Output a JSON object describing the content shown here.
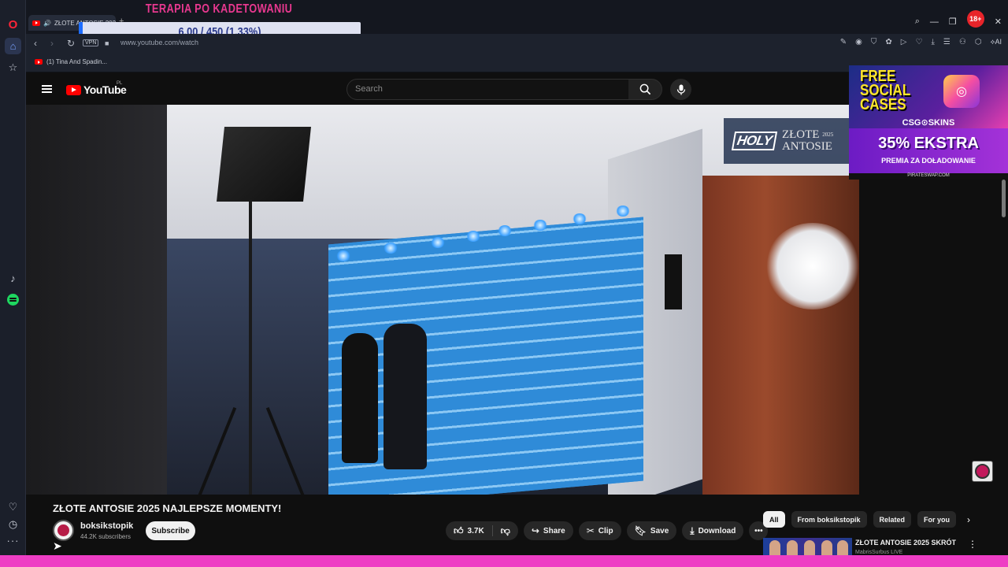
{
  "browser": {
    "tab_title": "ZŁOTE ANTOSIE 2025",
    "tab_add": "+",
    "badge": "18+",
    "url": "www.youtube.com/watch",
    "vpn_label": "VPN",
    "ai_label": "AI",
    "bookmark": "(1) Tina And Spadin..."
  },
  "overlay": {
    "title": "TERAPIA PO KADETOWANIU",
    "progress_text": "6.00 / 450 (1.33%)",
    "progress_fraction": 0.0133
  },
  "youtube": {
    "logo_text": "YouTube",
    "region": "PL",
    "search_placeholder": "Search"
  },
  "video_overlay": {
    "brand": "HOLY",
    "event": "ZŁOTE",
    "event2": "ANTOSIE",
    "year": "2025"
  },
  "ad": {
    "line1": "FREE",
    "line2": "SOCIAL",
    "line3": "CASES",
    "brand": "CSG⊙SKINS",
    "promo": "35% EKSTRA",
    "promo_sub": "PREMIA ZA DOŁADOWANIE",
    "site": "PIRATESWAP.COM"
  },
  "video": {
    "title": "ZŁOTE ANTOSIE 2025 NAJLEPSZE MOMENTY!",
    "channel": "boksikstopik",
    "subscribers": "44.2K subscribers",
    "subscribe_label": "Subscribe",
    "likes": "3.7K",
    "share_label": "Share",
    "clip_label": "Clip",
    "save_label": "Save",
    "download_label": "Download"
  },
  "chips": [
    "All",
    "From boksikstopik",
    "Related",
    "For you"
  ],
  "recommendation": {
    "title": "ZŁOTE ANTOSIE 2025 SKRÓT",
    "channel": "MabrisSurbus LIVE"
  },
  "icons": {
    "opera": "opera-logo-icon",
    "home": "home-icon",
    "star": "star-icon",
    "tiktok": "tiktok-icon",
    "spotify": "spotify-icon",
    "heart": "heart-icon",
    "history": "clock-icon",
    "more": "more-icon"
  },
  "colors": {
    "youtube_red": "#ff0000",
    "overlay_pink": "#e8388f",
    "progress_blue": "#1e6dff",
    "bottom_bar": "#ee3ec4"
  }
}
